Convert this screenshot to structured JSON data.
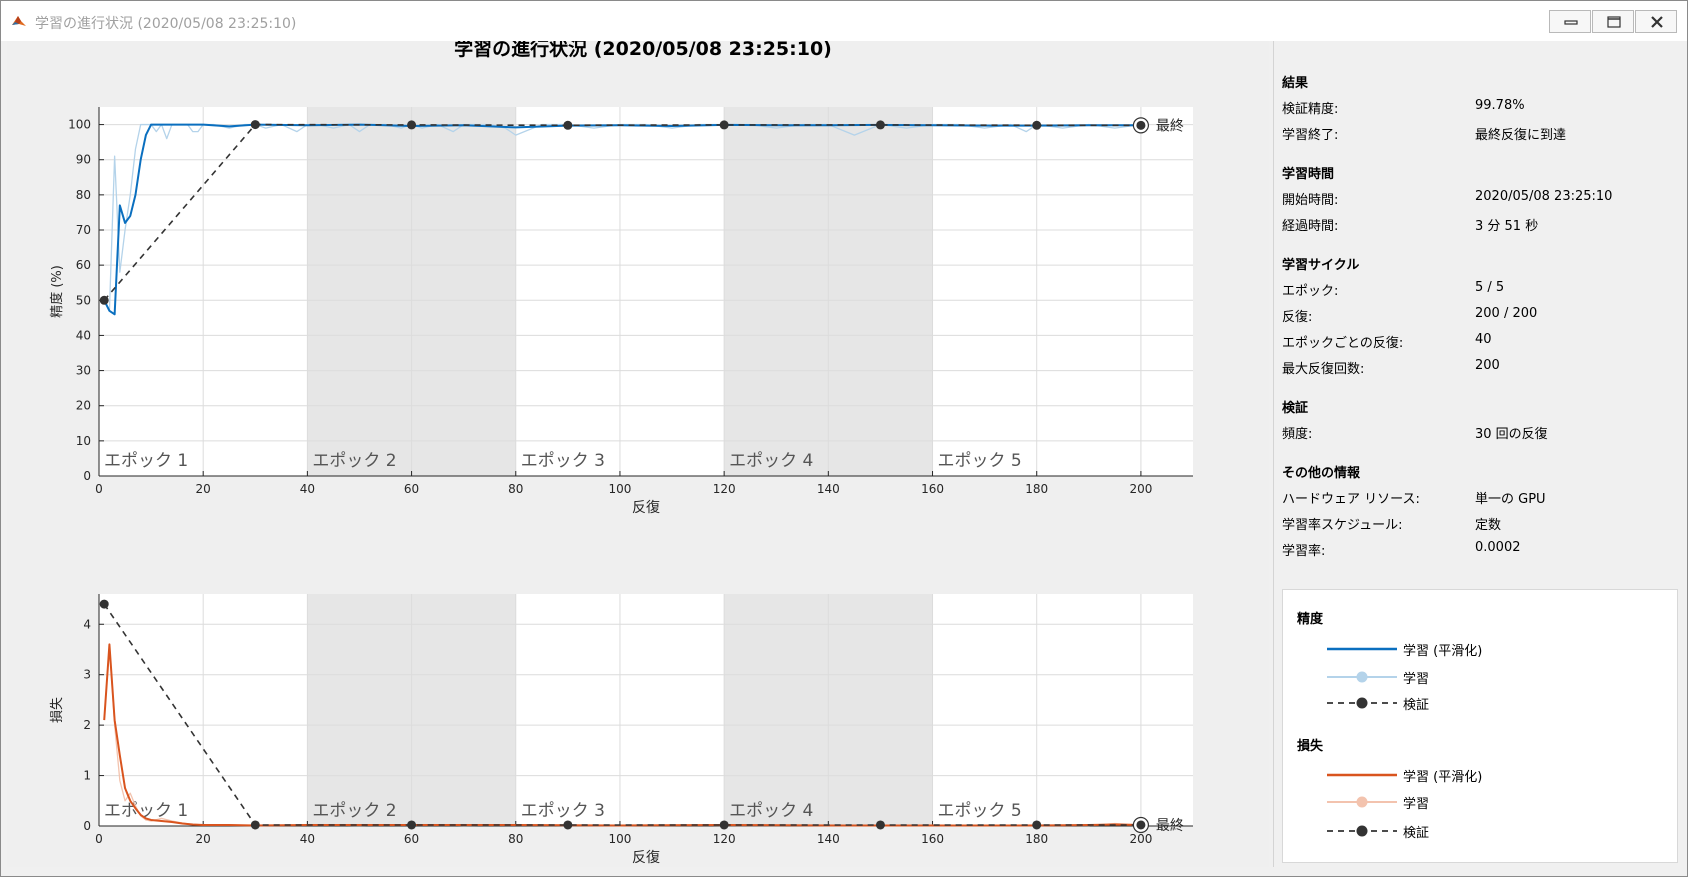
{
  "window": {
    "title": "学習の進行状況 (2020/05/08 23:25:10)"
  },
  "chart_title": "学習の進行状況 (2020/05/08 23:25:10)",
  "chart_data": [
    {
      "type": "line",
      "id": "accuracy",
      "ylabel": "精度 (%)",
      "xlabel": "反復",
      "xlim": [
        0,
        210
      ],
      "ylim": [
        0,
        105
      ],
      "xticks": [
        0,
        20,
        40,
        60,
        80,
        100,
        120,
        140,
        160,
        180,
        200
      ],
      "yticks": [
        0,
        10,
        20,
        30,
        40,
        50,
        60,
        70,
        80,
        90,
        100
      ],
      "grid": true,
      "epochs": [
        {
          "label": "エポック 1",
          "start": 0,
          "end": 40,
          "shaded": false
        },
        {
          "label": "エポック 2",
          "start": 40,
          "end": 80,
          "shaded": true
        },
        {
          "label": "エポック 3",
          "start": 80,
          "end": 120,
          "shaded": false
        },
        {
          "label": "エポック 4",
          "start": 120,
          "end": 160,
          "shaded": true
        },
        {
          "label": "エポック 5",
          "start": 160,
          "end": 200,
          "shaded": false
        }
      ],
      "final_label": "最終",
      "series": [
        {
          "name": "学習",
          "color": "#b4d3ea",
          "x": [
            1,
            2,
            3,
            4,
            5,
            6,
            7,
            8,
            9,
            10,
            11,
            12,
            13,
            14,
            15,
            16,
            17,
            18,
            19,
            20,
            22,
            25,
            28,
            30,
            32,
            35,
            38,
            40,
            42,
            45,
            48,
            50,
            52,
            55,
            58,
            60,
            62,
            65,
            68,
            70,
            75,
            78,
            80,
            85,
            90,
            95,
            100,
            105,
            110,
            115,
            120,
            125,
            130,
            135,
            140,
            145,
            150,
            155,
            160,
            165,
            170,
            175,
            178,
            180,
            185,
            190,
            195,
            200
          ],
          "y": [
            50,
            47,
            91,
            58,
            70,
            80,
            93,
            100,
            100,
            100,
            98,
            100,
            96,
            100,
            100,
            100,
            100,
            98,
            98,
            100,
            100,
            99,
            100,
            100,
            99,
            100,
            98,
            100,
            100,
            99,
            100,
            98,
            100,
            100,
            99,
            100,
            99,
            100,
            98,
            100,
            100,
            99,
            97,
            100,
            100,
            99,
            100,
            100,
            99,
            100,
            100,
            100,
            99,
            100,
            100,
            97,
            100,
            99,
            100,
            100,
            99,
            100,
            98,
            100,
            99,
            100,
            99,
            100
          ]
        },
        {
          "name": "学習 (平滑化)",
          "color": "#0a6fbf",
          "x": [
            1,
            2,
            3,
            4,
            5,
            6,
            7,
            8,
            9,
            10,
            11,
            12,
            15,
            20,
            25,
            30,
            40,
            50,
            60,
            70,
            80,
            90,
            100,
            110,
            120,
            130,
            140,
            150,
            160,
            170,
            180,
            190,
            200
          ],
          "y": [
            50,
            47,
            46,
            77,
            72,
            74,
            80,
            90,
            97,
            100,
            100,
            100,
            100,
            100,
            99.5,
            100,
            99.8,
            100,
            99.6,
            99.8,
            99.2,
            99.7,
            99.8,
            99.6,
            99.9,
            99.8,
            99.8,
            99.9,
            99.8,
            99.7,
            99.7,
            99.8,
            99.8
          ]
        },
        {
          "name": "検証",
          "color": "#333333",
          "dashed": true,
          "x": [
            1,
            30,
            60,
            90,
            120,
            150,
            180,
            200
          ],
          "y": [
            50,
            100,
            99.9,
            99.8,
            99.9,
            99.9,
            99.8,
            99.78
          ]
        }
      ]
    },
    {
      "type": "line",
      "id": "loss",
      "ylabel": "損失",
      "xlabel": "反復",
      "xlim": [
        0,
        210
      ],
      "ylim": [
        0,
        4.6
      ],
      "xticks": [
        0,
        20,
        40,
        60,
        80,
        100,
        120,
        140,
        160,
        180,
        200
      ],
      "yticks": [
        0,
        1,
        2,
        3,
        4
      ],
      "grid": true,
      "epochs": [
        {
          "label": "エポック 1",
          "start": 0,
          "end": 40,
          "shaded": false
        },
        {
          "label": "エポック 2",
          "start": 40,
          "end": 80,
          "shaded": true
        },
        {
          "label": "エポック 3",
          "start": 80,
          "end": 120,
          "shaded": false
        },
        {
          "label": "エポック 4",
          "start": 120,
          "end": 160,
          "shaded": true
        },
        {
          "label": "エポック 5",
          "start": 160,
          "end": 200,
          "shaded": false
        }
      ],
      "final_label": "最終",
      "series": [
        {
          "name": "学習",
          "color": "#f3c3ae",
          "x": [
            1,
            2,
            3,
            4,
            5,
            6,
            7,
            8,
            9,
            10,
            12,
            14,
            16,
            18,
            20,
            25,
            30,
            40,
            50,
            60,
            70,
            80,
            90,
            100,
            110,
            120,
            130,
            140,
            150,
            160,
            170,
            180,
            190,
            195,
            200
          ],
          "y": [
            2.1,
            3.6,
            2.0,
            0.9,
            0.5,
            0.65,
            0.4,
            0.2,
            0.12,
            0.1,
            0.15,
            0.1,
            0.06,
            0.03,
            0.02,
            0.02,
            0.01,
            0.02,
            0.01,
            0.03,
            0.01,
            0.02,
            0.01,
            0.01,
            0.02,
            0.01,
            0.01,
            0.02,
            0.01,
            0.02,
            0.01,
            0.02,
            0.01,
            0.05,
            0.02
          ]
        },
        {
          "name": "学習 (平滑化)",
          "color": "#d9541e",
          "x": [
            1,
            2,
            3,
            4,
            5,
            6,
            7,
            8,
            9,
            10,
            12,
            14,
            16,
            18,
            20,
            25,
            30,
            40,
            60,
            80,
            100,
            120,
            140,
            160,
            180,
            190,
            195,
            200
          ],
          "y": [
            2.1,
            3.6,
            2.1,
            1.4,
            0.75,
            0.5,
            0.35,
            0.22,
            0.15,
            0.12,
            0.1,
            0.08,
            0.05,
            0.03,
            0.02,
            0.02,
            0.01,
            0.02,
            0.02,
            0.02,
            0.01,
            0.02,
            0.01,
            0.01,
            0.01,
            0.02,
            0.03,
            0.02
          ]
        },
        {
          "name": "検証",
          "color": "#333333",
          "dashed": true,
          "x": [
            1,
            30,
            60,
            90,
            120,
            150,
            180,
            200
          ],
          "y": [
            4.4,
            0.02,
            0.02,
            0.02,
            0.02,
            0.02,
            0.02,
            0.02
          ]
        }
      ]
    }
  ],
  "panel": {
    "results": {
      "title": "結果",
      "rows": [
        {
          "label": "検証精度:",
          "value": "99.78%"
        },
        {
          "label": "学習終了:",
          "value": "最終反復に到達"
        }
      ]
    },
    "time": {
      "title": "学習時間",
      "rows": [
        {
          "label": "開始時間:",
          "value": "2020/05/08 23:25:10"
        },
        {
          "label": "経過時間:",
          "value": "3 分 51 秒"
        }
      ]
    },
    "cycle": {
      "title": "学習サイクル",
      "rows": [
        {
          "label": "エポック:",
          "value": "5 / 5"
        },
        {
          "label": "反復:",
          "value": "200 / 200"
        },
        {
          "label": "エポックごとの反復:",
          "value": "40"
        },
        {
          "label": "最大反復回数:",
          "value": "200"
        }
      ]
    },
    "validation": {
      "title": "検証",
      "rows": [
        {
          "label": "頻度:",
          "value": "30 回の反復"
        }
      ]
    },
    "other": {
      "title": "その他の情報",
      "rows": [
        {
          "label": "ハードウェア リソース:",
          "value": "単一の GPU"
        },
        {
          "label": "学習率スケジュール:",
          "value": "定数"
        },
        {
          "label": "学習率:",
          "value": "0.0002"
        }
      ]
    }
  },
  "legend": {
    "accuracy": {
      "title": "精度",
      "items": [
        {
          "label": "学習 (平滑化)",
          "color": "#0a6fbf",
          "kind": "line"
        },
        {
          "label": "学習",
          "color": "#b4d3ea",
          "kind": "line-marker"
        },
        {
          "label": "検証",
          "color": "#333333",
          "kind": "dashed-marker"
        }
      ]
    },
    "loss": {
      "title": "損失",
      "items": [
        {
          "label": "学習 (平滑化)",
          "color": "#d9541e",
          "kind": "line"
        },
        {
          "label": "学習",
          "color": "#f3c3ae",
          "kind": "line-marker"
        },
        {
          "label": "検証",
          "color": "#333333",
          "kind": "dashed-marker"
        }
      ]
    }
  }
}
